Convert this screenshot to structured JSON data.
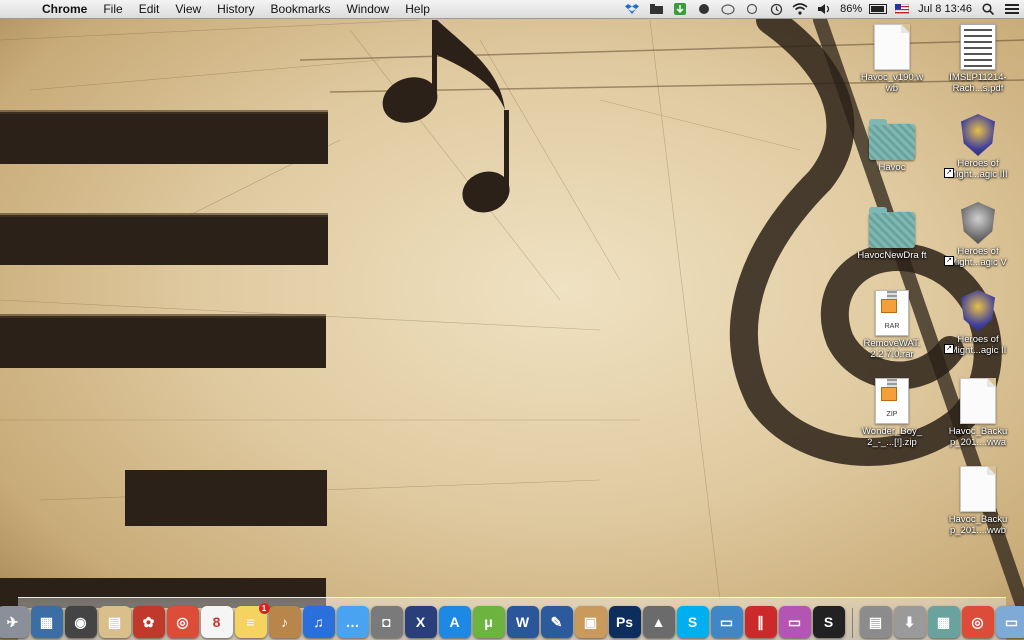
{
  "menubar": {
    "apple_glyph": "",
    "app_name": "Chrome",
    "menus": [
      "File",
      "Edit",
      "View",
      "History",
      "Bookmarks",
      "Window",
      "Help"
    ],
    "battery": "86%",
    "datetime": "Jul 8  13:46"
  },
  "desktop_icons": [
    {
      "label": "Havoc_v190.w wb",
      "kind": "document"
    },
    {
      "label": "IMSLP11214-Rach...s.pdf",
      "kind": "pdf"
    },
    {
      "label": "Havoc",
      "kind": "folder"
    },
    {
      "label": "Heroes of Might...agic III",
      "kind": "game-alias"
    },
    {
      "label": "HavocNewDra ft",
      "kind": "folder"
    },
    {
      "label": "Heroes of Might...agic V",
      "kind": "game-alias"
    },
    {
      "label": "RemoveWAT. 2.2.7.0.rar",
      "kind": "archive",
      "tag": "RAR"
    },
    {
      "label": "Heroes of Might...agic II",
      "kind": "game-alias"
    },
    {
      "label": "Wonder_Boy_ 2_-_...[!].zip",
      "kind": "archive",
      "tag": "ZIP"
    },
    {
      "label": "Havoc_Backu p_201....wwa",
      "kind": "document"
    },
    {
      "label": "Havoc_Backu p_201....wwb",
      "kind": "document"
    }
  ],
  "dock": {
    "apps": [
      {
        "name": "finder-icon",
        "glyph": "☺",
        "color": "#5aa0d8"
      },
      {
        "name": "launchpad-icon",
        "glyph": "✈",
        "color": "#8a8f99"
      },
      {
        "name": "mission-control-icon",
        "glyph": "▦",
        "color": "#3a6ea5"
      },
      {
        "name": "dashboard-icon",
        "glyph": "◉",
        "color": "#444"
      },
      {
        "name": "preview-icon",
        "glyph": "▤",
        "color": "#d9c08a"
      },
      {
        "name": "photo-booth-icon",
        "glyph": "✿",
        "color": "#c0392b"
      },
      {
        "name": "chrome-icon",
        "glyph": "◎",
        "color": "#dd4b39"
      },
      {
        "name": "calendar-icon",
        "glyph": "8",
        "color": "#f5f5f5"
      },
      {
        "name": "stickies-icon",
        "glyph": "≡",
        "color": "#f4d35e",
        "badge": "1"
      },
      {
        "name": "notes-icon",
        "glyph": "♪",
        "color": "#b8864a"
      },
      {
        "name": "itunes-icon",
        "glyph": "♫",
        "color": "#2a6fdb"
      },
      {
        "name": "messages-icon",
        "glyph": "…",
        "color": "#4aa3f0"
      },
      {
        "name": "facetime-icon",
        "glyph": "◘",
        "color": "#7a7a7a"
      },
      {
        "name": "x11-icon",
        "glyph": "X",
        "color": "#2a3f7a"
      },
      {
        "name": "app-store-icon",
        "glyph": "A",
        "color": "#1e88e5"
      },
      {
        "name": "utorrent-icon",
        "glyph": "μ",
        "color": "#6db33f"
      },
      {
        "name": "word-icon",
        "glyph": "W",
        "color": "#2b579a"
      },
      {
        "name": "xcode-icon",
        "glyph": "✎",
        "color": "#2d5a9c"
      },
      {
        "name": "archive-utility-icon",
        "glyph": "▣",
        "color": "#c99a5b"
      },
      {
        "name": "photoshop-icon",
        "glyph": "Ps",
        "color": "#0d2e5c"
      },
      {
        "name": "iphoto-icon",
        "glyph": "▲",
        "color": "#6b6b6b"
      },
      {
        "name": "skype-icon",
        "glyph": "S",
        "color": "#00aff0"
      },
      {
        "name": "remote-desktop-icon",
        "glyph": "▭",
        "color": "#3f87c7"
      },
      {
        "name": "parallels-icon",
        "glyph": "∥",
        "color": "#cc2a2a"
      },
      {
        "name": "bootcamp-icon",
        "glyph": "▭",
        "color": "#b455b4"
      },
      {
        "name": "sibelius-icon",
        "glyph": "S",
        "color": "#222"
      }
    ],
    "stacks": [
      {
        "name": "applications-stack-icon",
        "glyph": "▤",
        "color": "#8c8c8c"
      },
      {
        "name": "downloads-stack-icon",
        "glyph": "⬇",
        "color": "#9a9a9a"
      },
      {
        "name": "havoc-folder-stack-icon",
        "glyph": "▦",
        "color": "#6aa29d"
      },
      {
        "name": "chrome-stack-icon",
        "glyph": "◎",
        "color": "#dd4b39"
      },
      {
        "name": "documents-stack-icon",
        "glyph": "▭",
        "color": "#7fa9d6"
      },
      {
        "name": "trash-icon",
        "glyph": "🗑",
        "color": "#b5b5b5"
      }
    ]
  }
}
